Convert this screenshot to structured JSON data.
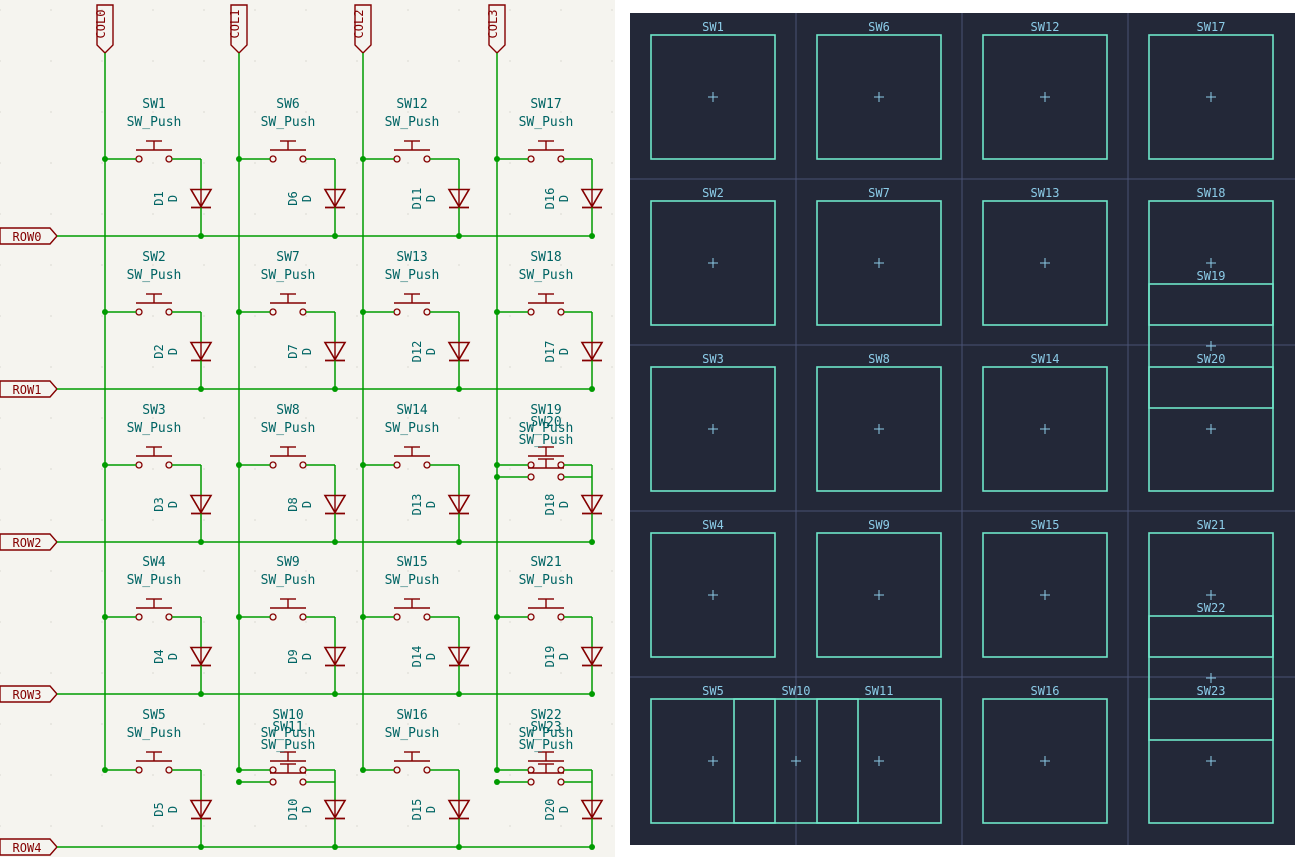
{
  "colors": {
    "schematic_bg": "#f5f4ef",
    "wire": "#009b00",
    "symbol": "#840000",
    "label_text": "#840000",
    "ref_text": "#006464",
    "pcb_bg": "#232838",
    "pcb_grid": "#4a5275",
    "pcb_outline": "#6ee6c8",
    "pcb_text": "#8ccce8"
  },
  "columns": [
    "COL0",
    "COL1",
    "COL2",
    "COL3"
  ],
  "rows": [
    "ROW0",
    "ROW1",
    "ROW2",
    "ROW3",
    "ROW4"
  ],
  "switches": [
    {
      "ref": "SW1",
      "value": "SW_Push",
      "col": 0,
      "row": 0
    },
    {
      "ref": "SW2",
      "value": "SW_Push",
      "col": 0,
      "row": 1
    },
    {
      "ref": "SW3",
      "value": "SW_Push",
      "col": 0,
      "row": 2
    },
    {
      "ref": "SW4",
      "value": "SW_Push",
      "col": 0,
      "row": 3
    },
    {
      "ref": "SW5",
      "value": "SW_Push",
      "col": 0,
      "row": 4
    },
    {
      "ref": "SW6",
      "value": "SW_Push",
      "col": 1,
      "row": 0
    },
    {
      "ref": "SW7",
      "value": "SW_Push",
      "col": 1,
      "row": 1
    },
    {
      "ref": "SW8",
      "value": "SW_Push",
      "col": 1,
      "row": 2
    },
    {
      "ref": "SW9",
      "value": "SW_Push",
      "col": 1,
      "row": 3
    },
    {
      "ref": "SW10",
      "value": "SW_Push",
      "col": 1,
      "row": 4
    },
    {
      "ref": "SW11",
      "value": "SW_Push",
      "col": 1,
      "row": 4,
      "overlap": 1
    },
    {
      "ref": "SW12",
      "value": "SW_Push",
      "col": 2,
      "row": 0
    },
    {
      "ref": "SW13",
      "value": "SW_Push",
      "col": 2,
      "row": 1
    },
    {
      "ref": "SW14",
      "value": "SW_Push",
      "col": 2,
      "row": 2
    },
    {
      "ref": "SW15",
      "value": "SW_Push",
      "col": 2,
      "row": 3
    },
    {
      "ref": "SW16",
      "value": "SW_Push",
      "col": 2,
      "row": 4
    },
    {
      "ref": "SW17",
      "value": "SW_Push",
      "col": 3,
      "row": 0
    },
    {
      "ref": "SW18",
      "value": "SW_Push",
      "col": 3,
      "row": 1
    },
    {
      "ref": "SW19",
      "value": "SW_Push",
      "col": 3,
      "row": 2
    },
    {
      "ref": "SW20",
      "value": "SW_Push",
      "col": 3,
      "row": 2,
      "overlap": 1
    },
    {
      "ref": "SW21",
      "value": "SW_Push",
      "col": 3,
      "row": 3
    },
    {
      "ref": "SW22",
      "value": "SW_Push",
      "col": 3,
      "row": 4
    },
    {
      "ref": "SW23",
      "value": "SW_Push",
      "col": 3,
      "row": 4,
      "overlap": 1
    }
  ],
  "diodes": [
    {
      "ref": "D1",
      "value": "D",
      "col": 0,
      "row": 0
    },
    {
      "ref": "D2",
      "value": "D",
      "col": 0,
      "row": 1
    },
    {
      "ref": "D3",
      "value": "D",
      "col": 0,
      "row": 2
    },
    {
      "ref": "D4",
      "value": "D",
      "col": 0,
      "row": 3
    },
    {
      "ref": "D5",
      "value": "D",
      "col": 0,
      "row": 4
    },
    {
      "ref": "D6",
      "value": "D",
      "col": 1,
      "row": 0
    },
    {
      "ref": "D7",
      "value": "D",
      "col": 1,
      "row": 1
    },
    {
      "ref": "D8",
      "value": "D",
      "col": 1,
      "row": 2
    },
    {
      "ref": "D9",
      "value": "D",
      "col": 1,
      "row": 3
    },
    {
      "ref": "D10",
      "value": "D",
      "col": 1,
      "row": 4
    },
    {
      "ref": "D11",
      "value": "D",
      "col": 2,
      "row": 0
    },
    {
      "ref": "D12",
      "value": "D",
      "col": 2,
      "row": 1
    },
    {
      "ref": "D13",
      "value": "D",
      "col": 2,
      "row": 2
    },
    {
      "ref": "D14",
      "value": "D",
      "col": 2,
      "row": 3
    },
    {
      "ref": "D15",
      "value": "D",
      "col": 2,
      "row": 4
    },
    {
      "ref": "D16",
      "value": "D",
      "col": 3,
      "row": 0
    },
    {
      "ref": "D17",
      "value": "D",
      "col": 3,
      "row": 1
    },
    {
      "ref": "D18",
      "value": "D",
      "col": 3,
      "row": 2
    },
    {
      "ref": "D19",
      "value": "D",
      "col": 3,
      "row": 3
    },
    {
      "ref": "D20",
      "value": "D",
      "col": 3,
      "row": 4
    }
  ],
  "pcb_footprints": [
    {
      "ref": "SW1",
      "col": 0,
      "row": 0
    },
    {
      "ref": "SW6",
      "col": 1,
      "row": 0
    },
    {
      "ref": "SW12",
      "col": 2,
      "row": 0
    },
    {
      "ref": "SW17",
      "col": 3,
      "row": 0
    },
    {
      "ref": "SW2",
      "col": 0,
      "row": 1
    },
    {
      "ref": "SW7",
      "col": 1,
      "row": 1
    },
    {
      "ref": "SW13",
      "col": 2,
      "row": 1
    },
    {
      "ref": "SW18",
      "col": 3,
      "row": 1
    },
    {
      "ref": "SW19",
      "col": 3,
      "row": 1.5
    },
    {
      "ref": "SW3",
      "col": 0,
      "row": 2
    },
    {
      "ref": "SW8",
      "col": 1,
      "row": 2
    },
    {
      "ref": "SW14",
      "col": 2,
      "row": 2
    },
    {
      "ref": "SW20",
      "col": 3,
      "row": 2
    },
    {
      "ref": "SW4",
      "col": 0,
      "row": 3
    },
    {
      "ref": "SW9",
      "col": 1,
      "row": 3
    },
    {
      "ref": "SW15",
      "col": 2,
      "row": 3
    },
    {
      "ref": "SW21",
      "col": 3,
      "row": 3
    },
    {
      "ref": "SW22",
      "col": 3,
      "row": 3.5
    },
    {
      "ref": "SW5",
      "col": 0,
      "row": 4
    },
    {
      "ref": "SW10",
      "col": 0.5,
      "row": 4
    },
    {
      "ref": "SW11",
      "col": 1,
      "row": 4
    },
    {
      "ref": "SW16",
      "col": 2,
      "row": 4
    },
    {
      "ref": "SW23",
      "col": 3,
      "row": 4
    }
  ]
}
